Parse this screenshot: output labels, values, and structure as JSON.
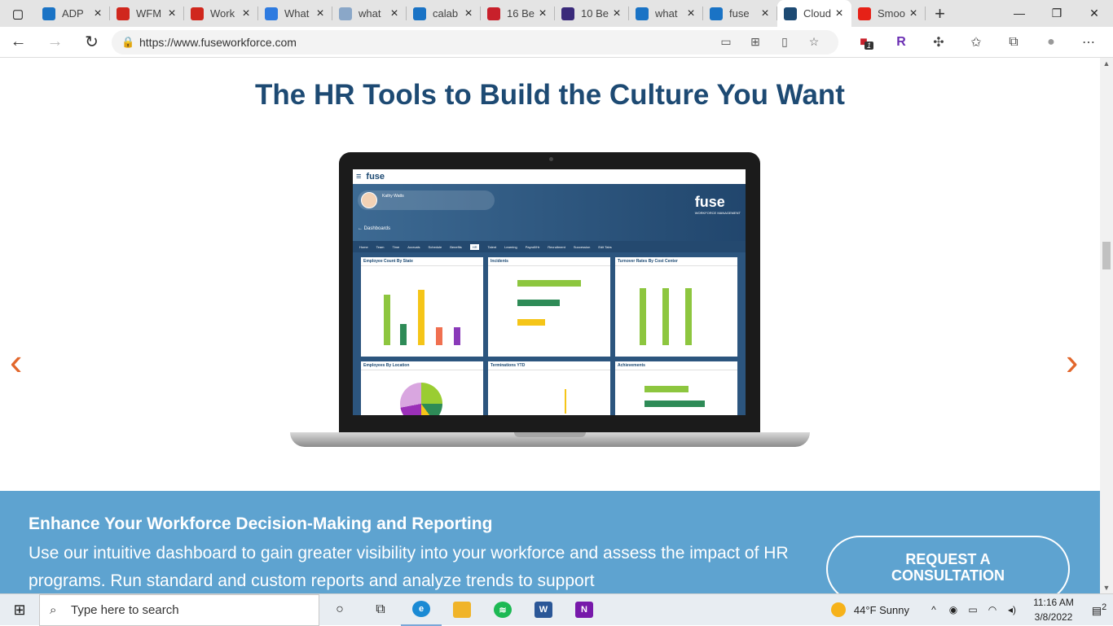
{
  "browser": {
    "tabs": [
      {
        "title": "ADP",
        "icon": "bing-icon",
        "color": "#1a73c5"
      },
      {
        "title": "WFM",
        "icon": "adp-icon",
        "color": "#d0271d"
      },
      {
        "title": "Work",
        "icon": "adp-icon",
        "color": "#d0271d"
      },
      {
        "title": "What",
        "icon": "bolt-icon",
        "color": "#2e7be0"
      },
      {
        "title": "what",
        "icon": "bing-icon",
        "color": "#8aa7c8"
      },
      {
        "title": "calab",
        "icon": "bing-icon",
        "color": "#1a73c5"
      },
      {
        "title": "16 Be",
        "icon": "fj-icon",
        "color": "#c8202b"
      },
      {
        "title": "10 Be",
        "icon": "site-icon",
        "color": "#3a2a7a"
      },
      {
        "title": "what",
        "icon": "bing-icon",
        "color": "#1a73c5"
      },
      {
        "title": "fuse",
        "icon": "bing-icon",
        "color": "#1a73c5"
      },
      {
        "title": "Cloud",
        "icon": "fuse-icon",
        "color": "#1d4a73",
        "active": true
      },
      {
        "title": "Smoo",
        "icon": "youtube-icon",
        "color": "#e62117"
      }
    ],
    "url": "https://www.fuseworkforce.com",
    "extension_badge": "1",
    "extension_letter": "R"
  },
  "page": {
    "headline": "The HR Tools to Build the Culture You Want",
    "band_title": "Enhance Your Workforce Decision-Making and Reporting",
    "band_text": "Use our intuitive dashboard to gain greater visibility into your workforce and assess the impact of HR programs. Run standard and custom reports and analyze trends to support",
    "cta_line1": "REQUEST A",
    "cta_line2": "CONSULTATION",
    "accent_color": "#1d4a73",
    "band_color": "#5ea3d0",
    "arrow_color": "#e2672c"
  },
  "dashboard": {
    "logo": "fuse",
    "brand": "fuse",
    "brand_sub": "WORKFORCE MANAGEMENT",
    "user_name": "Kathy Watts",
    "back_link": "← Dashboards",
    "tabs": [
      "Home",
      "Team",
      "Time",
      "Accruals",
      "Schedule",
      "Benefits",
      "HR",
      "Talent",
      "Learning",
      "Payroll/Hr",
      "Recruitment",
      "Succession",
      "Edit Tabs"
    ],
    "active_tab": "HR",
    "cards": [
      "Employee Count By State",
      "Incidents",
      "Turnover Rates By Cost Center",
      "Employees By Location",
      "Terminations YTD",
      "Achievements"
    ]
  },
  "taskbar": {
    "search_placeholder": "Type here to search",
    "weather": "44°F  Sunny",
    "time": "11:16 AM",
    "date": "3/8/2022",
    "notification_count": "2"
  }
}
